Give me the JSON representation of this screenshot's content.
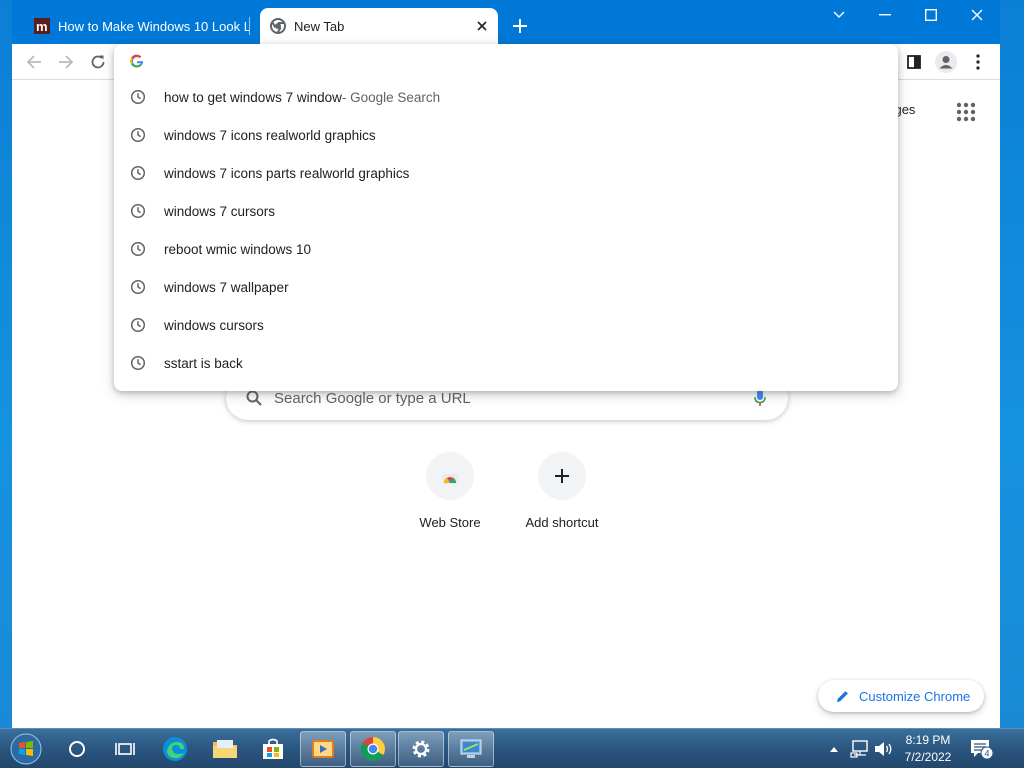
{
  "browser": {
    "tabs": [
      {
        "title": "How to Make Windows 10 Look L",
        "favicon": "m-site-icon",
        "active": false
      },
      {
        "title": "New Tab",
        "favicon": "chrome-icon",
        "active": true
      }
    ]
  },
  "omnibox": {
    "suggestions": [
      {
        "text": "how to get windows 7 window",
        "extra": " - Google Search"
      },
      {
        "text": "windows 7 icons realworld graphics",
        "extra": ""
      },
      {
        "text": "windows 7 icons parts realworld graphics",
        "extra": ""
      },
      {
        "text": "windows 7 cursors",
        "extra": ""
      },
      {
        "text": "reboot wmic windows 10",
        "extra": ""
      },
      {
        "text": "windows 7 wallpaper",
        "extra": ""
      },
      {
        "text": "windows cursors",
        "extra": ""
      },
      {
        "text": "sstart is back",
        "extra": ""
      }
    ]
  },
  "ntp": {
    "images_link": "nages",
    "search_placeholder": "Search Google or type a URL",
    "shortcuts": [
      {
        "label": "Web Store",
        "icon": "web-store-icon"
      },
      {
        "label": "Add shortcut",
        "icon": "plus-icon"
      }
    ],
    "customize_label": "Customize Chrome"
  },
  "taskbar": {
    "time": "8:19 PM",
    "date": "7/2/2022",
    "notification_count": "4"
  },
  "colors": {
    "titlebar": "#0078d7",
    "accent": "#1a73e8"
  }
}
